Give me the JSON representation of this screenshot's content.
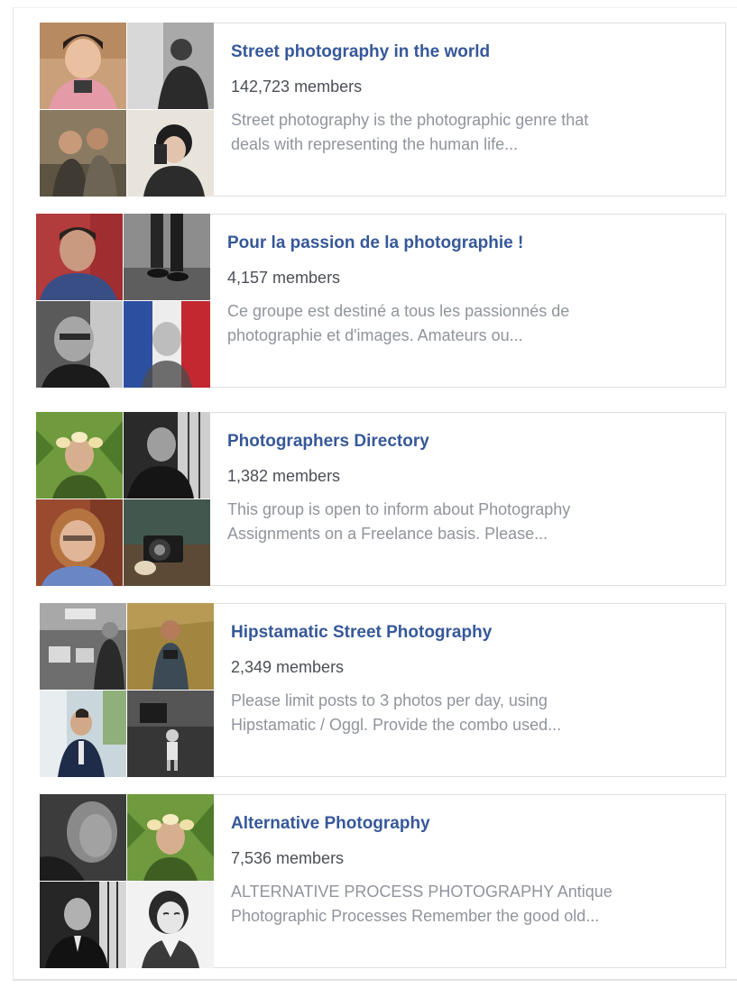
{
  "groups": [
    {
      "title": "Street photography in the world",
      "members": "142,723 members",
      "description_lines": [
        "Street photography is the photographic genre that",
        "deals with representing the human life..."
      ],
      "photos": [
        "woman-with-camera-photo",
        "man-in-bw-photo",
        "couple-with-camera-photo",
        "boy-with-camera-photo"
      ]
    },
    {
      "title": "Pour la passion de la photographie !",
      "members": "4,157 members",
      "description_lines": [
        "Ce groupe est destiné a tous les passionnés de",
        "photographie et d'images. Amateurs ou..."
      ],
      "photos": [
        "man-portrait-photo",
        "bw-legs-photo",
        "bw-smiling-man-photo",
        "man-flag-photo"
      ]
    },
    {
      "title": "Photographers Directory",
      "members": "1,382 members",
      "description_lines": [
        "This group is open to inform about Photography",
        "Assignments on a Freelance basis. Please..."
      ],
      "photos": [
        "flower-crown-woman-photo",
        "bw-man-window-photo",
        "woman-glasses-photo",
        "camera-photo"
      ]
    },
    {
      "title": "Hipstamatic Street Photography",
      "members": "2,349 members",
      "description_lines": [
        "Please limit posts to 3 photos per day, using",
        "Hipstamatic / Oggl. Provide the combo used..."
      ],
      "photos": [
        "bw-street-signs-photo",
        "man-in-grass-photo",
        "man-in-suit-photo",
        "bw-child-photo"
      ]
    },
    {
      "title": "Alternative Photography",
      "members": "7,536 members",
      "description_lines": [
        "ALTERNATIVE PROCESS PHOTOGRAPHY Antique",
        "Photographic Processes Remember the good old..."
      ],
      "photos": [
        "bw-man-face-photo",
        "flower-crown-woman-photo",
        "bw-man-portrait-photo",
        "sketch-woman-photo"
      ]
    }
  ],
  "colors": {
    "title": "#365899",
    "members": "#4b4f56",
    "description": "#90949c",
    "border": "#dddfe2"
  }
}
